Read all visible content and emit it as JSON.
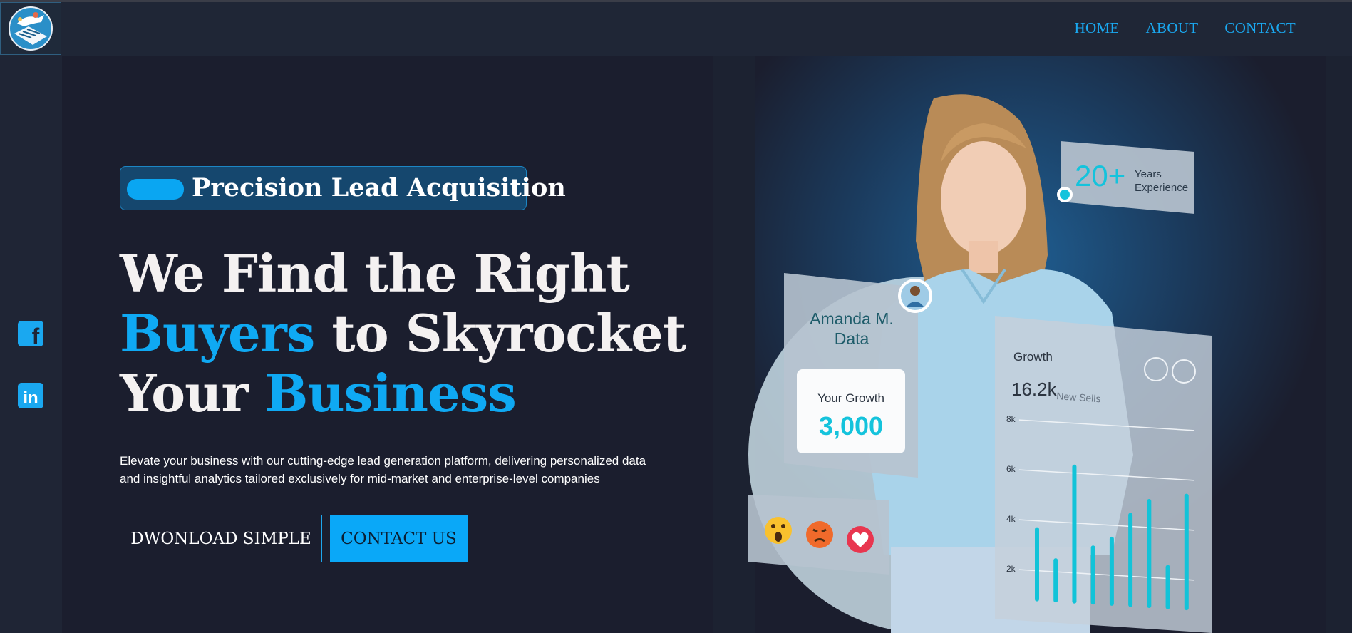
{
  "nav": {
    "links": [
      "HOME",
      "ABOUT",
      "CONTACT"
    ]
  },
  "social": {
    "facebook_icon": "facebook-icon",
    "linkedin_icon": "linkedin-icon",
    "facebook_glyph": "f",
    "linkedin_glyph": "in"
  },
  "hero": {
    "badge": "Precision Lead Acquisition",
    "headline": {
      "line1": "We Find the Right",
      "line2_accent": "Buyers",
      "line2_rest": " to Skyrocket",
      "line3_start": "Your ",
      "line3_accent": "Business"
    },
    "description": "Elevate your business with our cutting-edge lead generation platform, delivering personalized data and insightful analytics tailored exclusively for mid-market and enterprise-level companies",
    "buttons": {
      "download": "DWONLOAD SIMPLE",
      "contact": "CONTACT US"
    }
  },
  "illustration": {
    "experience": {
      "value": "20+",
      "label_line1": "Years",
      "label_line2": "Experience"
    },
    "profile": {
      "name_line1": "Amanda M.",
      "name_line2": "Data"
    },
    "growth_card": {
      "label": "Your Growth",
      "value": "3,000"
    },
    "chart": {
      "title": "Growth",
      "value": "16.2k",
      "value_label": "New Sells",
      "y_ticks": [
        "8k",
        "6k",
        "4k",
        "2k"
      ]
    },
    "reactions": [
      "surprised-emoji",
      "angry-emoji",
      "heart-icon"
    ]
  },
  "chart_data": {
    "type": "bar",
    "title": "Growth",
    "y_ticks": [
      "8k",
      "6k",
      "4k",
      "2k"
    ],
    "values": [
      2.8,
      1.6,
      5.4,
      2.2,
      2.6,
      3.6,
      4.2,
      1.6,
      4.5
    ],
    "ylim": [
      0,
      8
    ],
    "color": "#12c3d8"
  },
  "colors": {
    "accent": "#0fa9f3",
    "background": "#1b1e2e",
    "headline": "#f4f1f1",
    "chart_bar": "#12c3d8"
  }
}
